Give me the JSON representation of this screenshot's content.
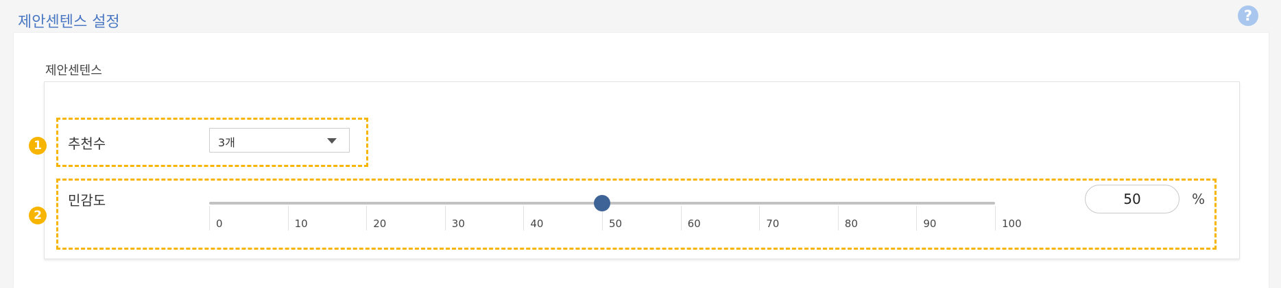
{
  "header": {
    "title": "제안센텐스 설정",
    "help_icon": "?"
  },
  "section": {
    "title": "제안센텐스"
  },
  "recommendation": {
    "badge": "1",
    "label": "추천수",
    "selected": "3개"
  },
  "sensitivity": {
    "badge": "2",
    "label": "민감도",
    "value": 50,
    "value_text": "50",
    "unit": "%",
    "min": 0,
    "max": 100,
    "ticks": [
      "0",
      "10",
      "20",
      "30",
      "40",
      "50",
      "60",
      "70",
      "80",
      "90",
      "100"
    ]
  },
  "colors": {
    "accent": "#f7b500",
    "title": "#4a78c2",
    "thumb": "#3e6396",
    "help_icon": "#a9c7ee"
  }
}
